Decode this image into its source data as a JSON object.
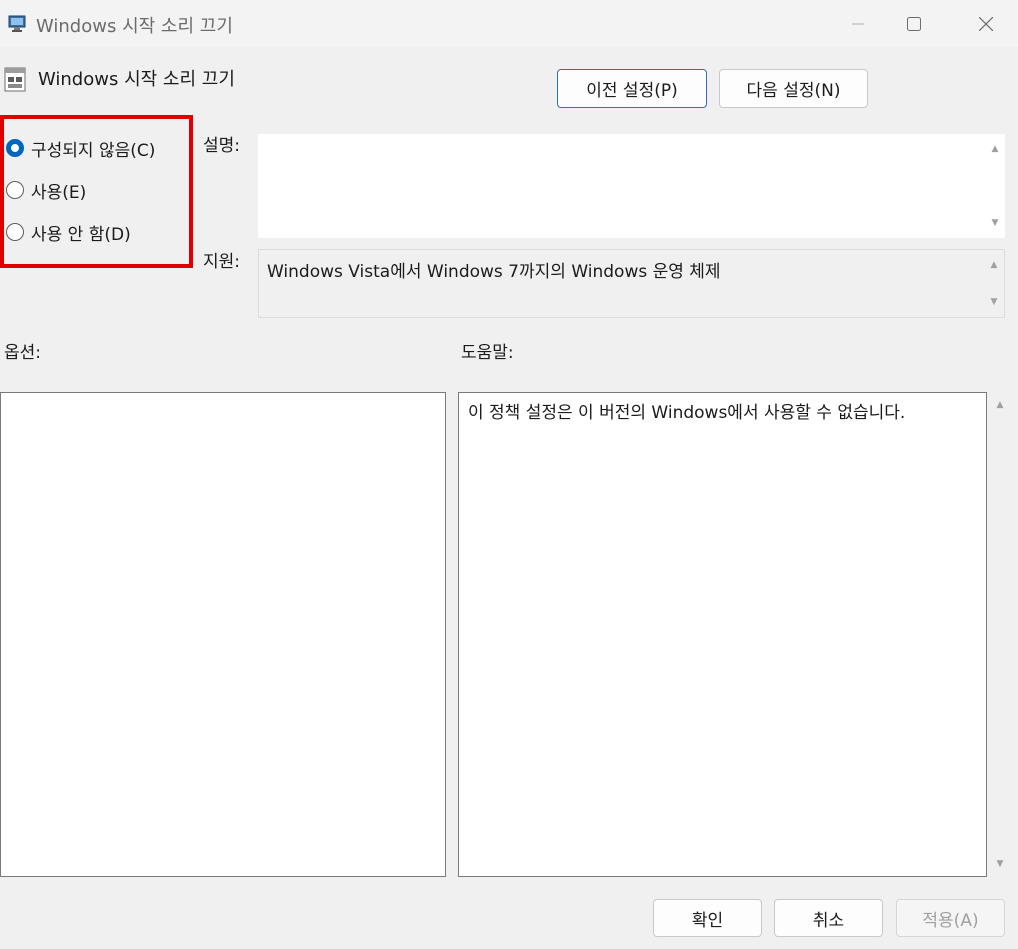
{
  "window": {
    "title": "Windows 시작 소리 끄기",
    "controls": {
      "minimize_icon": "minimize-icon",
      "maximize_icon": "maximize-icon",
      "close_icon": "close-icon"
    }
  },
  "header": {
    "policy_title": "Windows 시작 소리 끄기",
    "prev_button": "이전 설정(P)",
    "next_button": "다음 설정(N)"
  },
  "state": {
    "options": [
      {
        "label": "구성되지 않음(C)",
        "checked": true
      },
      {
        "label": "사용(E)",
        "checked": false
      },
      {
        "label": "사용 안 함(D)",
        "checked": false
      }
    ],
    "highlight_color": "#e00000"
  },
  "description": {
    "label": "설명:",
    "text": ""
  },
  "supported": {
    "label": "지원:",
    "text": "Windows Vista에서 Windows 7까지의 Windows 운영 체제"
  },
  "options_panel": {
    "label": "옵션:"
  },
  "help_panel": {
    "label": "도움말:",
    "text": "이 정책 설정은 이 버전의 Windows에서 사용할 수 없습니다."
  },
  "footer": {
    "ok": "확인",
    "cancel": "취소",
    "apply": "적용(A)",
    "apply_enabled": false
  },
  "colors": {
    "accent": "#0067c0",
    "background": "#f0f0f0"
  }
}
